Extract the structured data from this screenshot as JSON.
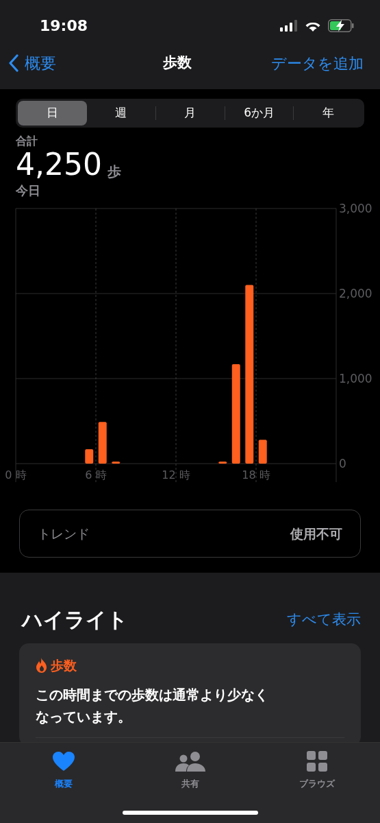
{
  "status_bar": {
    "time": "19:08"
  },
  "nav": {
    "back": "概要",
    "title": "歩数",
    "action": "データを追加"
  },
  "segments": [
    {
      "label": "日",
      "selected": true
    },
    {
      "label": "週",
      "selected": false
    },
    {
      "label": "月",
      "selected": false
    },
    {
      "label": "6か月",
      "selected": false
    },
    {
      "label": "年",
      "selected": false
    }
  ],
  "summary": {
    "label": "合計",
    "value": "4,250",
    "unit": "歩",
    "period": "今日"
  },
  "chart": {
    "chart_data": {
      "type": "bar",
      "x": [
        5.5,
        6.5,
        7.5,
        15.5,
        16.5,
        17.5,
        18.5
      ],
      "xlim": [
        0,
        24
      ],
      "grid": true,
      "series": [
        {
          "color": "#ff5f1f",
          "values": [
            170,
            490,
            20,
            20,
            1170,
            2100,
            280
          ]
        }
      ],
      "ylim": [
        0,
        3000
      ],
      "xticks": [
        {
          "value": 0,
          "label": "0 時"
        },
        {
          "value": 6,
          "label": "6 時"
        },
        {
          "value": 12,
          "label": "12 時"
        },
        {
          "value": 18,
          "label": "18 時"
        }
      ],
      "yticks": [
        {
          "value": 0,
          "label": "0"
        },
        {
          "value": 1000,
          "label": "1,000"
        },
        {
          "value": 2000,
          "label": "2,000"
        },
        {
          "value": 3000,
          "label": "3,000"
        }
      ]
    }
  },
  "trend": {
    "label": "トレンド",
    "value": "使用不可"
  },
  "highlights": {
    "title": "ハイライト",
    "link": "すべて表示",
    "card": {
      "category": "歩数",
      "text": "この時間までの歩数は通常より少なくなっています。"
    }
  },
  "tab_bar": [
    {
      "kind": "heart",
      "label": "概要",
      "selected": true
    },
    {
      "kind": "people",
      "label": "共有",
      "selected": false
    },
    {
      "kind": "grid",
      "label": "ブラウズ",
      "selected": false
    }
  ]
}
